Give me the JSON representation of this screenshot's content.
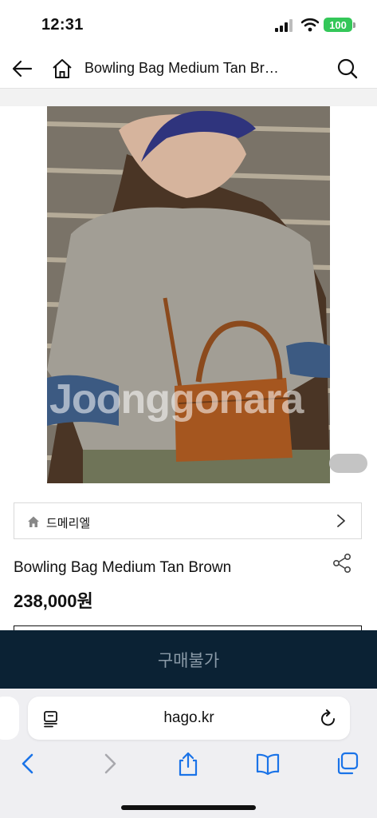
{
  "status_bar": {
    "time": "12:31",
    "battery": "100"
  },
  "header": {
    "title": "Bowling Bag Medium Tan Br…"
  },
  "image": {
    "watermark": "Joonggonara"
  },
  "brand": {
    "label": "드메리엘"
  },
  "product": {
    "name": "Bowling Bag Medium Tan Brown",
    "price": "238,000원"
  },
  "buy_bar": {
    "label": "구매불가"
  },
  "browser": {
    "url": "hago.kr"
  },
  "icons": [
    "back-arrow-icon",
    "home-icon",
    "search-icon",
    "share-icon",
    "chevron-right-icon",
    "reader-icon",
    "reload-icon",
    "back-icon",
    "forward-icon",
    "share-sheet-icon",
    "bookmarks-icon",
    "tabs-icon"
  ],
  "colors": {
    "buy_bar_bg": "#0b2234",
    "buy_label": "#8a9aa7",
    "battery": "#34c759",
    "browser_accent": "#1a73e8"
  }
}
